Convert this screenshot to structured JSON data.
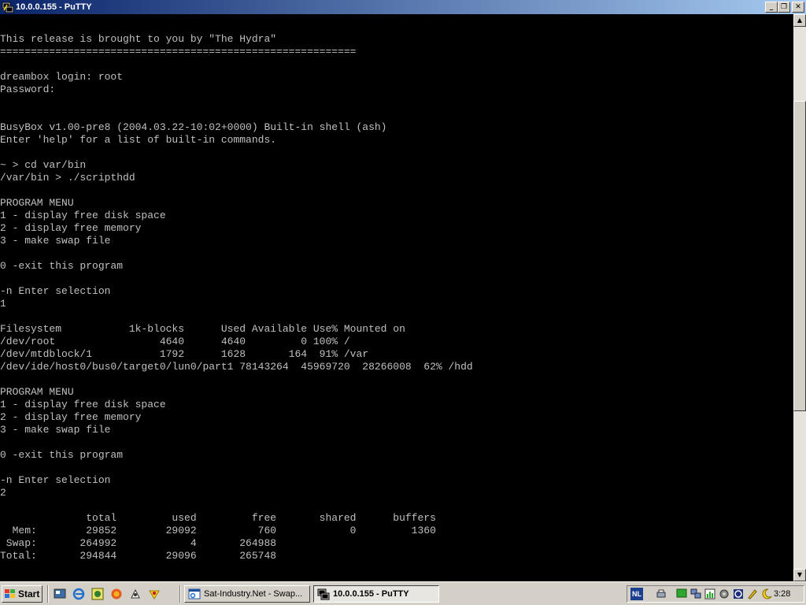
{
  "window": {
    "title": "10.0.0.155 - PuTTY",
    "min_glyph": "_",
    "max_glyph": "❐",
    "close_glyph": "✕"
  },
  "terminal": {
    "lines": [
      "This release is brought to you by \"The Hydra\"",
      "==========================================================",
      "",
      "dreambox login: root",
      "Password:",
      "",
      "",
      "BusyBox v1.00-pre8 (2004.03.22-10:02+0000) Built-in shell (ash)",
      "Enter 'help' for a list of built-in commands.",
      "",
      "~ > cd var/bin",
      "/var/bin > ./scripthdd",
      "",
      "PROGRAM MENU",
      "1 - display free disk space",
      "2 - display free memory",
      "3 - make swap file",
      "",
      "0 -exit this program",
      "",
      "-n Enter selection",
      "1",
      "",
      "Filesystem           1k-blocks      Used Available Use% Mounted on",
      "/dev/root                 4640      4640         0 100% /",
      "/dev/mtdblock/1           1792      1628       164  91% /var",
      "/dev/ide/host0/bus0/target0/lun0/part1 78143264  45969720  28266008  62% /hdd",
      "",
      "PROGRAM MENU",
      "1 - display free disk space",
      "2 - display free memory",
      "3 - make swap file",
      "",
      "0 -exit this program",
      "",
      "-n Enter selection",
      "2",
      "",
      "              total         used         free       shared      buffers",
      "  Mem:        29852        29092          760            0         1360",
      " Swap:       264992            4       264988",
      "Total:       294844        29096       265748"
    ]
  },
  "scrollbar": {
    "up_glyph": "▲",
    "down_glyph": "▼",
    "position_fraction": 0.32
  },
  "taskbar": {
    "start_label": "Start",
    "tasks": [
      {
        "label": "Sat-Industry.Net - Swap...",
        "active": false
      },
      {
        "label": "10.0.0.155 - PuTTY",
        "active": true
      }
    ],
    "tray_language": "NL",
    "clock": "3:28"
  },
  "colors": {
    "terminal_bg": "#000000",
    "terminal_fg": "#c0c0c0",
    "titlebar_start": "#0a246a",
    "titlebar_end": "#a6caf0",
    "chrome": "#d4d0c8"
  }
}
